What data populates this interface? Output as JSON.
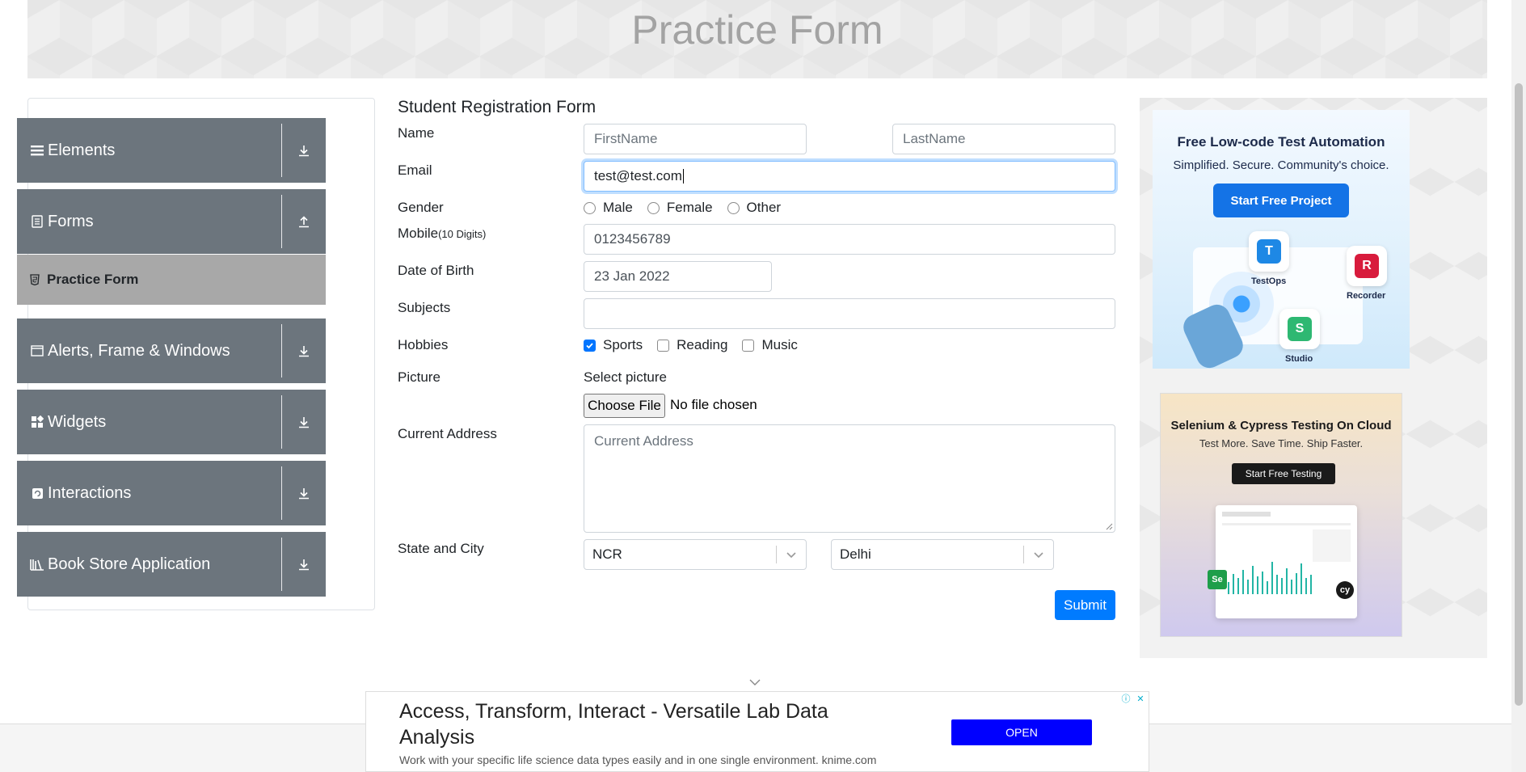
{
  "banner": {
    "title": "Practice Form"
  },
  "menu": {
    "groups": [
      {
        "label": "Elements",
        "icon": "list-icon"
      },
      {
        "label": "Forms",
        "icon": "document-icon"
      },
      {
        "label": "Alerts, Frame & Windows",
        "icon": "window-icon"
      },
      {
        "label": "Widgets",
        "icon": "widgets-icon"
      },
      {
        "label": "Interactions",
        "icon": "interaction-icon"
      },
      {
        "label": "Book Store Application",
        "icon": "books-icon"
      }
    ],
    "active_sub_item": {
      "label": "Practice Form"
    }
  },
  "form": {
    "title": "Student Registration Form",
    "name_label": "Name",
    "first_name_placeholder": "FirstName",
    "last_name_placeholder": "LastName",
    "email_label": "Email",
    "email_value": "test@test.com",
    "gender_label": "Gender",
    "gender_options": [
      "Male",
      "Female",
      "Other"
    ],
    "mobile_label": "Mobile",
    "mobile_hint": "(10 Digits)",
    "mobile_value": "0123456789",
    "dob_label": "Date of Birth",
    "dob_value": "23 Jan 2022",
    "subjects_label": "Subjects",
    "subjects_value": "",
    "hobbies_label": "Hobbies",
    "hobbies": [
      {
        "label": "Sports",
        "checked": true
      },
      {
        "label": "Reading",
        "checked": false
      },
      {
        "label": "Music",
        "checked": false
      }
    ],
    "picture_label": "Picture",
    "select_picture_label": "Select picture",
    "choose_file_label": "Choose File",
    "no_file_text": "No file chosen",
    "address_label": "Current Address",
    "address_placeholder": "Current Address",
    "state_city_label": "State and City",
    "state_value": "NCR",
    "city_value": "Delhi",
    "submit_label": "Submit"
  },
  "ads": {
    "katalon": {
      "title": "Free Low-code Test Automation",
      "subtitle": "Simplified. Secure. Community's choice.",
      "button": "Start Free Project",
      "tiles": [
        "TestOps",
        "Recorder",
        "Studio"
      ]
    },
    "lambdatest": {
      "title": "Selenium & Cypress Testing On Cloud",
      "subtitle": "Test More. Save Time. Ship Faster.",
      "button": "Start Free Testing"
    },
    "knime": {
      "title": "Access, Transform, Interact - Versatile Lab Data Analysis",
      "subtitle": "Work with your specific life science data types easily and in one single environment. knime.com",
      "button": "OPEN"
    }
  },
  "colors": {
    "menu_bg": "#6c757d",
    "active_item_bg": "#a8a8a8",
    "primary": "#007bff",
    "checkbox": "#0075ff"
  }
}
